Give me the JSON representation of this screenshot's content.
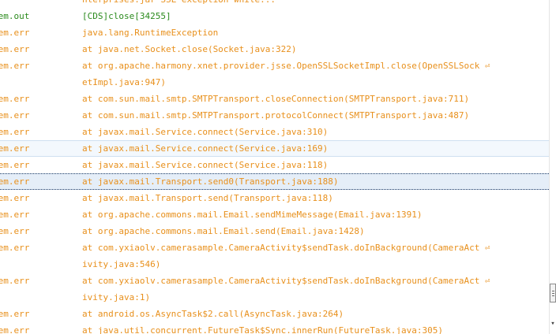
{
  "log": {
    "rows": [
      {
        "tag": "",
        "message": "nterprises.jar  SSL exception while..."
      },
      {
        "tag": "tem.out",
        "message": "[CDS]close[34255]"
      },
      {
        "tag": "tem.err",
        "message": "java.lang.RuntimeException"
      },
      {
        "tag": "tem.err",
        "message": "at java.net.Socket.close(Socket.java:322)"
      },
      {
        "tag": "tem.err",
        "message": "at org.apache.harmony.xnet.provider.jsse.OpenSSLSocketImpl.close(OpenSSLSock"
      },
      {
        "tag": "",
        "message": "etImpl.java:947)"
      },
      {
        "tag": "tem.err",
        "message": "at com.sun.mail.smtp.SMTPTransport.closeConnection(SMTPTransport.java:711)"
      },
      {
        "tag": "tem.err",
        "message": "at com.sun.mail.smtp.SMTPTransport.protocolConnect(SMTPTransport.java:487)"
      },
      {
        "tag": "tem.err",
        "message": "at javax.mail.Service.connect(Service.java:310)"
      },
      {
        "tag": "tem.err",
        "message": "at javax.mail.Service.connect(Service.java:169)"
      },
      {
        "tag": "tem.err",
        "message": "at javax.mail.Service.connect(Service.java:118)"
      },
      {
        "tag": "tem.err",
        "message": "at javax.mail.Transport.send0(Transport.java:188)"
      },
      {
        "tag": "tem.err",
        "message": "at javax.mail.Transport.send(Transport.java:118)"
      },
      {
        "tag": "tem.err",
        "message": "at org.apache.commons.mail.Email.sendMimeMessage(Email.java:1391)"
      },
      {
        "tag": "tem.err",
        "message": "at org.apache.commons.mail.Email.send(Email.java:1428)"
      },
      {
        "tag": "tem.err",
        "message": "at com.yxiaolv.camerasample.CameraActivity$sendTask.doInBackground(CameraAct"
      },
      {
        "tag": "",
        "message": "ivity.java:546)"
      },
      {
        "tag": "tem.err",
        "message": "at com.yxiaolv.camerasample.CameraActivity$sendTask.doInBackground(CameraAct"
      },
      {
        "tag": "",
        "message": "ivity.java:1)"
      },
      {
        "tag": "tem.err",
        "message": "at android.os.AsyncTask$2.call(AsyncTask.java:264)"
      },
      {
        "tag": "tem.err",
        "message": "at java.util.concurrent.FutureTask$Sync.innerRun(FutureTask.java:305)"
      }
    ],
    "wrap_marker": "⏎"
  },
  "colors": {
    "stdout": "#2a8a1c",
    "stderr": "#e8901c",
    "hover_row_bg": "#f3f8fd",
    "selected_row_bg": "#e5eef8"
  },
  "scrollbar": {
    "down_arrow": "▾"
  }
}
